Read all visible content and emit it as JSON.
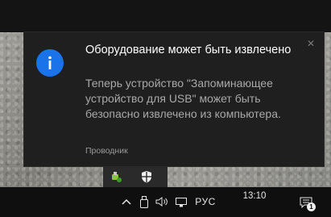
{
  "toast": {
    "title": "Оборудование может быть извлечено",
    "body": "Теперь устройство \"Запоминающее устройство для USB\" может быть безопасно извлечено из компьютера.",
    "source": "Проводник",
    "icon": "info-icon",
    "accent_color": "#1a73e8"
  },
  "tray_overflow": {
    "icons": [
      "usb-safely-remove-icon",
      "windows-defender-icon"
    ]
  },
  "taskbar": {
    "icons": [
      "chevron-up-icon",
      "usb-drive-icon",
      "volume-icon",
      "network-icon"
    ],
    "language": "РУС",
    "time": "13:10",
    "notification_count": "1"
  }
}
